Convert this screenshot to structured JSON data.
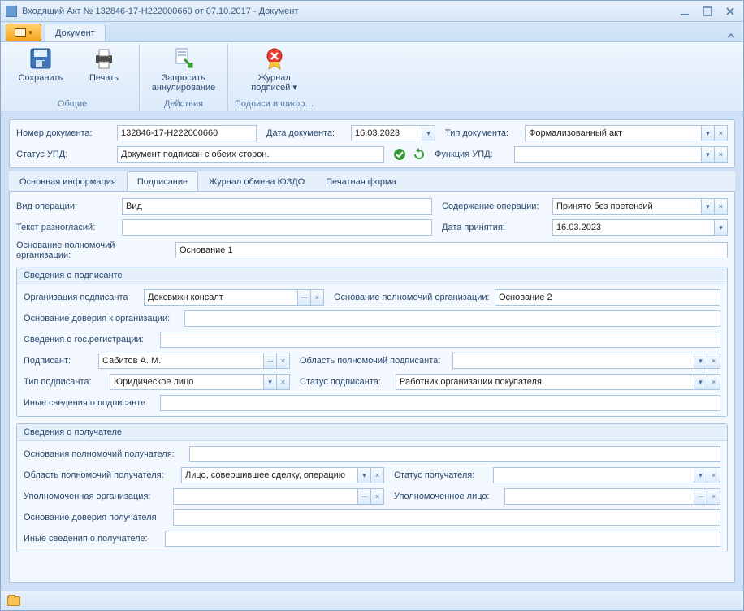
{
  "window": {
    "title": "Входящий Акт № 132846-17-H222000660 от 07.10.2017 - Документ"
  },
  "ribbon": {
    "tab": "Документ",
    "save": "Сохранить",
    "print": "Печать",
    "request_cancel_l1": "Запросить",
    "request_cancel_l2": "аннулирование",
    "sign_journal_l1": "Журнал",
    "sign_journal_l2": "подписей",
    "group_common": "Общие",
    "group_actions": "Действия",
    "group_sign": "Подписи и шифр…"
  },
  "header": {
    "doc_number_label": "Номер документа:",
    "doc_number": "132846-17-H222000660",
    "doc_date_label": "Дата документа:",
    "doc_date": "16.03.2023",
    "doc_type_label": "Тип документа:",
    "doc_type": "Формализованный акт",
    "upd_status_label": "Статус УПД:",
    "upd_status": "Документ подписан с обеих сторон.",
    "upd_func_label": "Функция УПД:"
  },
  "tabs": {
    "t0": "Основная информация",
    "t1": "Подписание",
    "t2": "Журнал обмена ЮЗДО",
    "t3": "Печатная форма"
  },
  "sign": {
    "op_kind_label": "Вид операции:",
    "op_kind": "Вид",
    "op_content_label": "Содержание операции:",
    "op_content": "Принято без претензий",
    "dis_text_label": "Текст разногласий:",
    "accept_date_label": "Дата принятия:",
    "accept_date": "16.03.2023",
    "org_auth_basis_label": "Основание полномочий организации:",
    "org_auth_basis": "Основание 1",
    "signer_group": "Сведения о подписанте",
    "signer_org_label": "Организация подписанта",
    "signer_org": "Доксвижн консалт",
    "signer_auth_basis_label": "Основание полномочий организации:",
    "signer_auth_basis": "Основание 2",
    "trust_basis_label": "Основание доверия к организации:",
    "gov_reg_label": "Сведения о гос.регистрации:",
    "signer_label": "Подписант:",
    "signer": "Сабитов А. М.",
    "signer_auth_area_label": "Область полномочий подписанта:",
    "signer_type_label": "Тип подписанта:",
    "signer_type": "Юридическое лицо",
    "signer_status_label": "Статус подписанта:",
    "signer_status": "Работник организации покупателя",
    "signer_other_label": "Иные сведения о подписанте:",
    "recipient_group": "Сведения о получателе",
    "recip_auth_basis_label": "Основания полномочий получателя:",
    "recip_auth_area_label": "Область полномочий получателя:",
    "recip_auth_area": "Лицо, совершившее сделку, операцию",
    "recip_status_label": "Статус получателя:",
    "recip_org_label": "Уполномоченная организация:",
    "recip_person_label": "Уполномоченное лицо:",
    "recip_trust_label": "Основание доверия получателя",
    "recip_other_label": "Иные сведения о получателе:"
  }
}
